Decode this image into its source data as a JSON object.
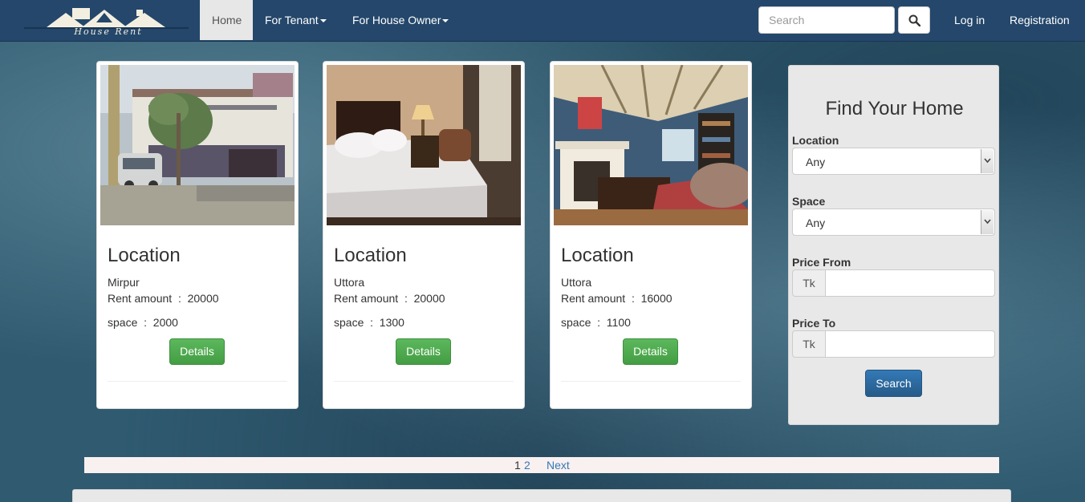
{
  "brand": {
    "logo_text": "House Rent"
  },
  "nav": {
    "home": "Home",
    "tenant": "For Tenant",
    "owner": "For House Owner",
    "login": "Log in",
    "register": "Registration"
  },
  "search": {
    "placeholder": "Search",
    "value": ""
  },
  "cards": [
    {
      "title": "Location",
      "location": "Mirpur",
      "rent": "Rent amount  :  20000",
      "space": "space  :  2000",
      "details": "Details",
      "image": "house-exterior-photo"
    },
    {
      "title": "Location",
      "location": "Uttora",
      "rent": "Rent amount  :  20000",
      "space": "space  :  1300",
      "details": "Details",
      "image": "bedroom-photo"
    },
    {
      "title": "Location",
      "location": "Uttora",
      "rent": "Rent amount  :  16000",
      "space": "space  :  1100",
      "details": "Details",
      "image": "living-room-photo"
    }
  ],
  "finder": {
    "title": "Find Your Home",
    "location_label": "Location",
    "location_value": "Any",
    "space_label": "Space",
    "space_value": "Any",
    "price_from_label": "Price From",
    "price_to_label": "Price To",
    "currency": "Tk",
    "search_label": "Search"
  },
  "pagination": {
    "current": "1",
    "page2": "2",
    "next": "Next"
  },
  "colors": {
    "navbar": "#24476b",
    "accent_blue": "#337ab7",
    "success_green": "#5cb85c"
  }
}
